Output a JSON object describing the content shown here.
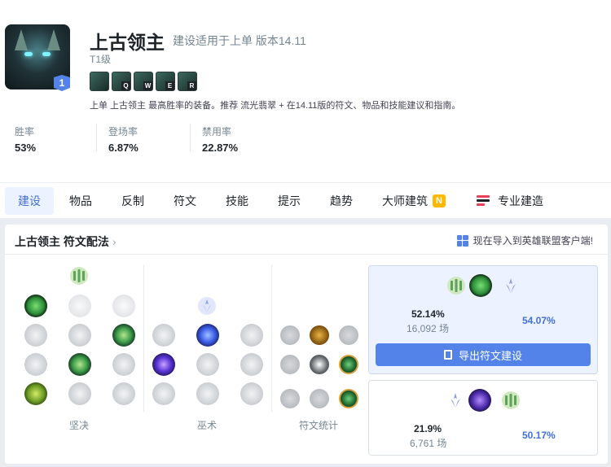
{
  "champion": {
    "name": "上古领主",
    "subtitle": "建设适用于上单 版本14.11",
    "tier_text": "T1级",
    "tier_badge": "1",
    "skills": [
      {
        "key": "",
        "icon": "passive-icon"
      },
      {
        "key": "Q",
        "icon": "skill-q-icon"
      },
      {
        "key": "W",
        "icon": "skill-w-icon"
      },
      {
        "key": "E",
        "icon": "skill-e-icon"
      },
      {
        "key": "R",
        "icon": "skill-r-icon"
      }
    ],
    "description": "上单 上古领主 最高胜率的装备。推荐 流光翡翠 + 在14.11版的符文、物品和技能建议和指南。"
  },
  "stats": [
    {
      "label": "胜率",
      "value": "53%"
    },
    {
      "label": "登场率",
      "value": "6.87%"
    },
    {
      "label": "禁用率",
      "value": "22.87%"
    }
  ],
  "nav": {
    "tabs": [
      "建设",
      "物品",
      "反制",
      "符文",
      "技能",
      "提示",
      "趋势",
      "大师建筑",
      "专业建造"
    ],
    "active": "建设",
    "new_badge": "N"
  },
  "runes_panel": {
    "title": "上古领主 符文配法",
    "import_text": "现在导入到英雄联盟客户端!",
    "column_labels": [
      "坚决",
      "巫术",
      "符文统计"
    ],
    "builds": [
      {
        "pick_rate": "52.14%",
        "games": "16,092 场",
        "win_rate": "54.07%",
        "export_label": "导出符文建设"
      },
      {
        "pick_rate": "21.9%",
        "games": "6,761 场",
        "win_rate": "50.17%"
      }
    ]
  },
  "colors": {
    "accent": "#5383e8",
    "active_tab_bg": "#ecf2ff",
    "badge_yellow": "#ffb900",
    "win_rate_blue": "#4171d6"
  }
}
